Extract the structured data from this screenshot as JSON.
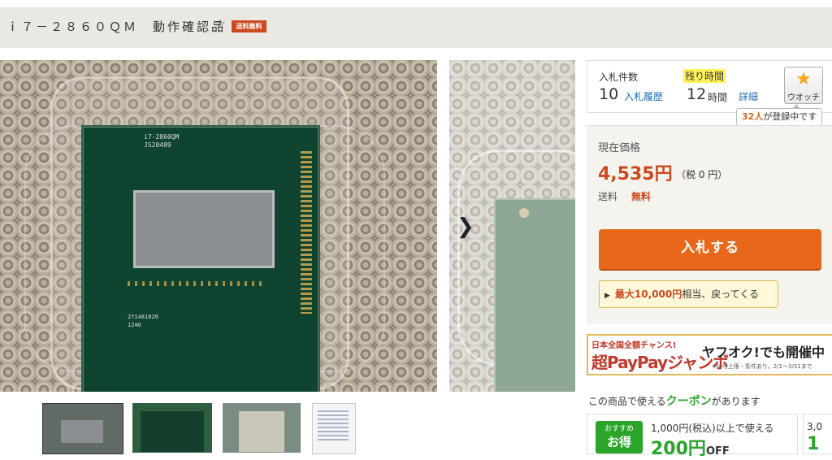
{
  "header": {
    "title": "ｉ７－２８６０ＱＭ　動作確認品",
    "watch_star": "☆",
    "shipping_badge": "送料無料"
  },
  "photo": {
    "main_labels": [
      "i7-2860QM",
      "JS20489",
      "2Y1481826",
      "1246"
    ],
    "nav_arrow": "❯"
  },
  "bids": {
    "label": "入札件数",
    "count": "10",
    "history_link": "入札履歴"
  },
  "remaining": {
    "label": "残り時間",
    "value": "12",
    "unit": "時間",
    "detail_link": "詳細"
  },
  "watch": {
    "label": "ウオッチ",
    "count": "32人",
    "tooltip_suffix": "が登録中です"
  },
  "price": {
    "label": "現在価格",
    "value": "4,535円",
    "tax": "（税 0 円）",
    "shipping_label": "送料",
    "shipping_value": "無料"
  },
  "bid_button": "入札する",
  "reward": {
    "amount": "最大10,000円",
    "text": "相当、戻ってくる"
  },
  "banner": {
    "line1": "日本全国全額チャンス!",
    "line2": "超PayPayジャンボ",
    "right1": "ヤフオク!でも開催中",
    "right2": "※付与上限・条件あり。2/1～3/31まで"
  },
  "coupon": {
    "heading_pre": "この商品で使える",
    "heading_em": "クーポン",
    "heading_post": "があります",
    "badge_small": "おすすめ",
    "badge_big": "お得",
    "condition": "1,000円(税込)以上で使える",
    "amount": "200円",
    "off": "OFF",
    "second_condition": "3,0",
    "second_amount": "1"
  },
  "colors": {
    "accent": "#e8681b",
    "price": "#cc4a1f",
    "coupon": "#2aa52a",
    "link": "#1e6eb4"
  }
}
